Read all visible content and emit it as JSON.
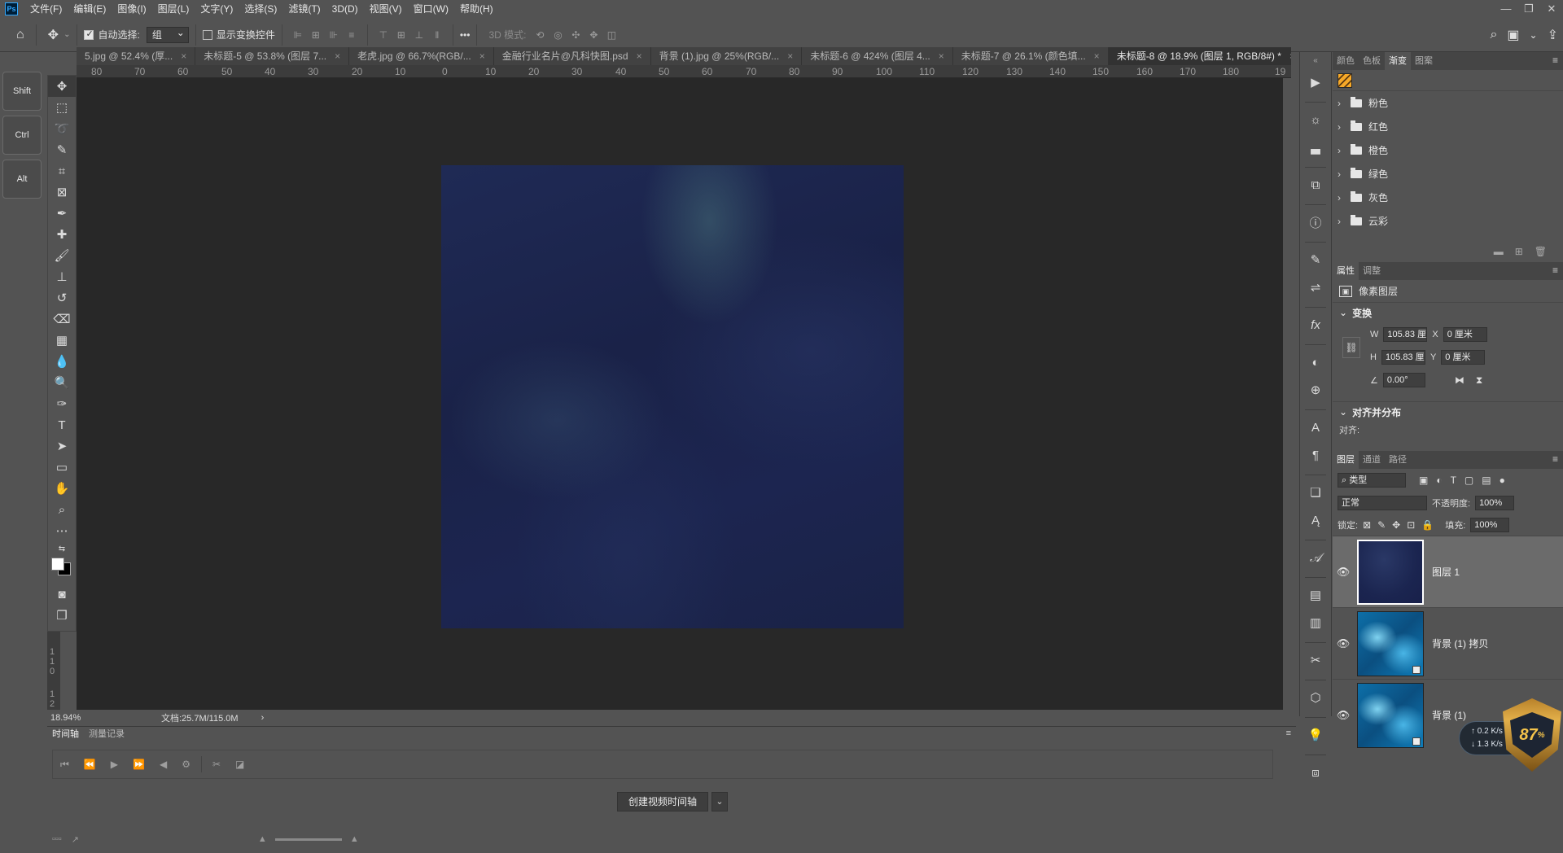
{
  "menubar": {
    "logo": "Ps",
    "items": [
      "文件(F)",
      "编辑(E)",
      "图像(I)",
      "图层(L)",
      "文字(Y)",
      "选择(S)",
      "滤镜(T)",
      "3D(D)",
      "视图(V)",
      "窗口(W)",
      "帮助(H)"
    ],
    "window_controls": [
      "—",
      "❐",
      "✕"
    ]
  },
  "options": {
    "auto_select_label": "自动选择:",
    "auto_select_value": "组",
    "show_transform_label": "显示变换控件",
    "mode_3d_label": "3D 模式:",
    "more": "•••"
  },
  "keys": [
    "Shift",
    "Ctrl",
    "Alt"
  ],
  "tabs": [
    {
      "label": "5.jpg @ 52.4% (厚...",
      "active": false
    },
    {
      "label": "未标题-5 @ 53.8% (图层 7...",
      "active": false
    },
    {
      "label": "老虎.jpg @ 66.7%(RGB/...",
      "active": false
    },
    {
      "label": "金融行业名片@凡科快图.psd",
      "active": false
    },
    {
      "label": "背景 (1).jpg @ 25%(RGB/...",
      "active": false
    },
    {
      "label": "未标题-6 @ 424% (图层 4...",
      "active": false
    },
    {
      "label": "未标题-7 @ 26.1% (颜色填...",
      "active": false
    },
    {
      "label": "未标题-8 @ 18.9% (图层 1, RGB/8#) *",
      "active": true
    }
  ],
  "ruler": {
    "top_labels": [
      "80",
      "70",
      "60",
      "50",
      "40",
      "30",
      "20",
      "10",
      "0",
      "10",
      "20",
      "30",
      "40",
      "50",
      "60",
      "70",
      "80",
      "90",
      "100",
      "110",
      "120",
      "130",
      "140",
      "150",
      "160",
      "170",
      "180",
      "19"
    ],
    "left_labels": [
      "1",
      "1",
      "0",
      "1",
      "2"
    ]
  },
  "status": {
    "zoom": "18.94%",
    "doc_info": "文档:25.7M/115.0M",
    "arrow": "›"
  },
  "timeline": {
    "tabs": [
      "时间轴",
      "测量记录"
    ],
    "create_button": "创建视频时间轴",
    "dropdown": "⌄"
  },
  "swatches_panel": {
    "tabs": [
      "颜色",
      "色板",
      "渐变",
      "图案"
    ],
    "active_tab": "渐变",
    "folders": [
      "粉色",
      "红色",
      "橙色",
      "绿色",
      "灰色",
      "云彩"
    ]
  },
  "properties_panel": {
    "tabs": [
      "属性",
      "调整"
    ],
    "layer_type": "像素图层",
    "transform_title": "变换",
    "w_label": "W",
    "w_value": "105.83 厘",
    "h_label": "H",
    "h_value": "105.83 厘",
    "x_label": "X",
    "x_value": "0 厘米",
    "y_label": "Y",
    "y_value": "0 厘米",
    "angle_value": "0.00°",
    "align_title": "对齐并分布",
    "align_label": "对齐:"
  },
  "layers_panel": {
    "tabs": [
      "图层",
      "通道",
      "路径"
    ],
    "filter_value": "类型",
    "blend_mode": "正常",
    "opacity_label": "不透明度:",
    "opacity_value": "100%",
    "lock_label": "锁定:",
    "fill_label": "填充:",
    "fill_value": "100%",
    "layers": [
      {
        "name": "图层 1",
        "selected": true
      },
      {
        "name": "背景 (1) 拷贝",
        "selected": false
      },
      {
        "name": "背景 (1)",
        "selected": false
      }
    ]
  },
  "network": {
    "up": "0.2",
    "down": "1.3",
    "unit": "K/s"
  },
  "badge": {
    "value": "87"
  }
}
